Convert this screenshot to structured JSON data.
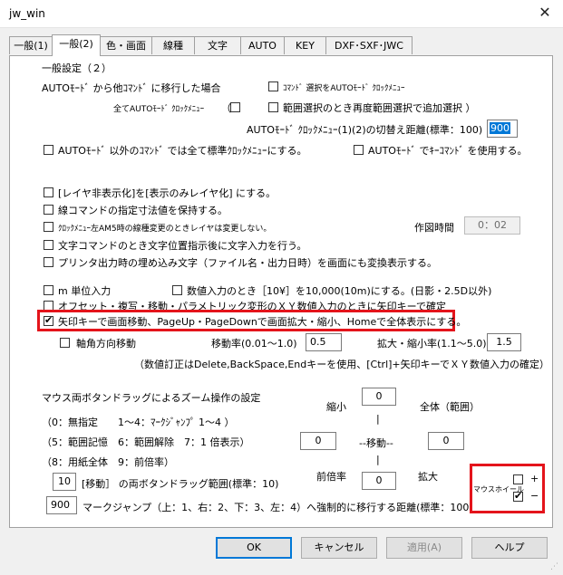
{
  "window": {
    "title": "jw_win",
    "close_glyph": "✕"
  },
  "tabs": [
    "一般(1)",
    "一般(2)",
    "色・画面",
    "線種",
    "文字",
    "AUTO",
    "KEY",
    "DXF･SXF･JWC"
  ],
  "section_title": "一般設定（２）",
  "auto": {
    "label": "AUTOﾓｰﾄﾞ から他ｺﾏﾝﾄﾞ に移行した場合",
    "cmd_select_label": "ｺﾏﾝﾄﾞ 選択をAUTOﾓｰﾄﾞ ｸﾛｯｸﾒﾆｭｰ",
    "all_auto_label": "全てAUTOﾓｰﾄﾞ ｸﾛｯｸﾒﾆｭｰ",
    "range_reselect_label": "範囲選択のとき再度範囲選択で追加選択 ）",
    "distance_label": "AUTOﾓｰﾄﾞ ｸﾛｯｸﾒﾆｭｰ(1)(2)の切替え距離(標準：100)",
    "distance_value": "900",
    "non_auto_label": "AUTOﾓｰﾄﾞ 以外のｺﾏﾝﾄﾞ では全て標準ｸﾛｯｸﾒﾆｭｰにする。",
    "key_command_label": "AUTOﾓｰﾄﾞ でｷｰｺﾏﾝﾄﾞ を使用する。"
  },
  "options": {
    "layer_hide": "[レイヤ非表示化]を[表示のみレイヤ化] にする。",
    "line_keep": "線コマンドの指定寸法値を保持する。",
    "clock_am5": "ｸﾛｯｸﾒﾆｭｰ左AM5時の線種変更のときレイヤは変更しない。",
    "draw_time_label": "作図時間",
    "draw_time_value": "0：02",
    "text_input": "文字コマンドのとき文字位置指示後に文字入力を行う。",
    "print_embed": "プリンタ出力時の埋め込み文字（ファイル名・出力日時）を画面にも変換表示する。",
    "m_unit": "m 単位入力",
    "numeric_input": "数値入力のとき［10¥］を10,000(10m)にする。(日影・2.5D以外)",
    "offset_input": "オフセット・複写・移動・パラメトリック変形のＸＹ数値入力のときに矢印キーで確定",
    "arrow_keys": "矢印キーで画面移動、PageUp・PageDownで画面拡大・縮小、Homeで全体表示にする。",
    "axis_move": "軸角方向移動",
    "move_rate_label": "移動率(0.01～1.0)",
    "move_rate_value": "0.5",
    "zoom_rate_label": "拡大・縮小率(1.1～5.0)",
    "zoom_rate_value": "1.5",
    "note": "（数値訂正はDelete,BackSpace,Endキーを使用、[Ctrl]+矢印キーでＸＹ数値入力の確定）"
  },
  "zoom": {
    "title": "マウス両ボタンドラッグによるズーム操作の設定",
    "legend1": "（0：無指定　　1～4：ﾏｰｸｼﾞｬﾝﾌﾟ 1～4 ）",
    "legend2": "（5：範囲記憶　6：範囲解除　7：1 倍表示）",
    "legend3": "（8：用紙全体　9：前倍率）",
    "shrink_label": "縮小",
    "shrink_value": "0",
    "all_label": "全体（範囲）",
    "left_value": "0",
    "move_label": "--移動--",
    "right_value": "0",
    "prev_label": "前倍率",
    "prev_value": "0",
    "enlarge_label": "拡大",
    "bar_top": "|",
    "bar_bottom": "|",
    "drag_value": "10",
    "drag_label": "[移動］ の両ボタンドラッグ範囲(標準：10)",
    "jump_value": "900",
    "jump_label": "マークジャンプ（上：1、右：2、下：3、左：4）へ強制的に移行する距離(標準：100)",
    "wheel_label": "マウスホイール",
    "wheel_plus": "+",
    "wheel_minus": "−"
  },
  "buttons": {
    "ok": "OK",
    "cancel": "キャンセル",
    "apply": "適用(A)",
    "help": "ヘルプ"
  }
}
